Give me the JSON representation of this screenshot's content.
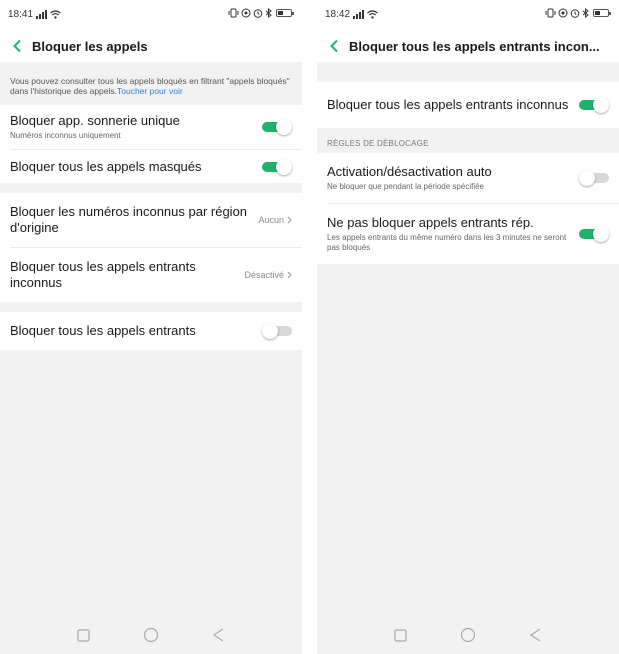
{
  "left": {
    "status": {
      "time": "18:41"
    },
    "header": {
      "title": "Bloquer les appels"
    },
    "info": {
      "text": "Vous pouvez consulter tous les appels bloqués en filtrant \"appels bloqués\" dans l'historique des appels.",
      "link": "Toucher pour voir"
    },
    "rows": [
      {
        "label": "Bloquer app. sonnerie unique",
        "sub": "Numéros inconnus uniquement",
        "toggle": "on"
      },
      {
        "label": "Bloquer tous les appels masqués",
        "toggle": "on"
      },
      {
        "label": "Bloquer les numéros inconnus par région d'origine",
        "value": "Aucun"
      },
      {
        "label": "Bloquer tous les appels entrants inconnus",
        "value": "Désactivé"
      },
      {
        "label": "Bloquer tous les appels entrants",
        "toggle": "off"
      }
    ]
  },
  "right": {
    "status": {
      "time": "18:42"
    },
    "header": {
      "title": "Bloquer tous les appels entrants incon..."
    },
    "rows": [
      {
        "label": "Bloquer tous les appels entrants inconnus",
        "toggle": "on"
      }
    ],
    "section": "RÈGLES DE DÉBLOCAGE",
    "rules": [
      {
        "label": "Activation/désactivation auto",
        "sub": "Ne bloquer que pendant la période spécifiée",
        "toggle": "off"
      },
      {
        "label": "Ne pas bloquer appels entrants rép.",
        "sub": "Les appels entrants du même numéro dans les 3 minutes ne seront pas bloqués",
        "toggle": "on"
      }
    ]
  },
  "colors": {
    "accent": "#1fb26d",
    "link": "#2f83d8",
    "background": "#f2f2f2"
  },
  "icons": [
    "back-chevron-icon",
    "signal-icon",
    "wifi-icon",
    "vibrate-icon",
    "alarm-icon",
    "bluetooth-icon",
    "battery-icon",
    "nav-square-icon",
    "nav-circle-icon",
    "nav-back-icon",
    "chevron-right-icon"
  ]
}
